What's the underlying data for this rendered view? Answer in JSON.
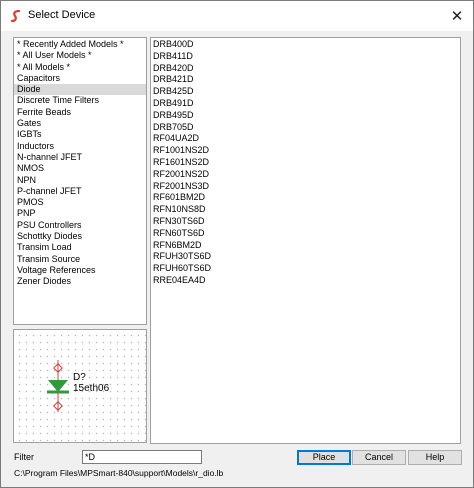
{
  "window": {
    "title": "Select Device",
    "close_glyph": "✕",
    "app_icon": "simetrix-s-icon"
  },
  "categories": {
    "items": [
      "* Recently Added Models *",
      "* All User Models *",
      "* All Models *",
      "Capacitors",
      "Diode",
      "Discrete Time Filters",
      "Ferrite Beads",
      "Gates",
      "IGBTs",
      "Inductors",
      "N-channel JFET",
      "NMOS",
      "NPN",
      "P-channel JFET",
      "PMOS",
      "PNP",
      "PSU Controllers",
      "Schottky Diodes",
      "Transim Load",
      "Transim Source",
      "Voltage References",
      "Zener Diodes"
    ],
    "selected_index": 4
  },
  "devices": {
    "items": [
      "DRB400D",
      "DRB411D",
      "DRB420D",
      "DRB421D",
      "DRB425D",
      "DRB491D",
      "DRB495D",
      "DRB705D",
      "RF04UA2D",
      "RF1001NS2D",
      "RF1601NS2D",
      "RF2001NS2D",
      "RF2001NS3D",
      "RF601BM2D",
      "RFN10NS8D",
      "RFN30TS6D",
      "RFN60TS6D",
      "RFN6BM2D",
      "RFUH30TS6D",
      "RFUH60TS6D",
      "RRE04EA4D"
    ]
  },
  "preview": {
    "ref": "D?",
    "value": "15eth06",
    "symbol_color": "#2e9a3a",
    "pin_color": "#d04040"
  },
  "filter": {
    "label": "Filter",
    "value": "*D"
  },
  "buttons": {
    "place": "Place",
    "cancel": "Cancel",
    "help": "Help"
  },
  "path": "C:\\Program Files\\MPSmart-840\\support\\Models\\r_dio.lb",
  "colors": {
    "selection": "#d9d9d9",
    "default_button_border": "#0078d7"
  }
}
